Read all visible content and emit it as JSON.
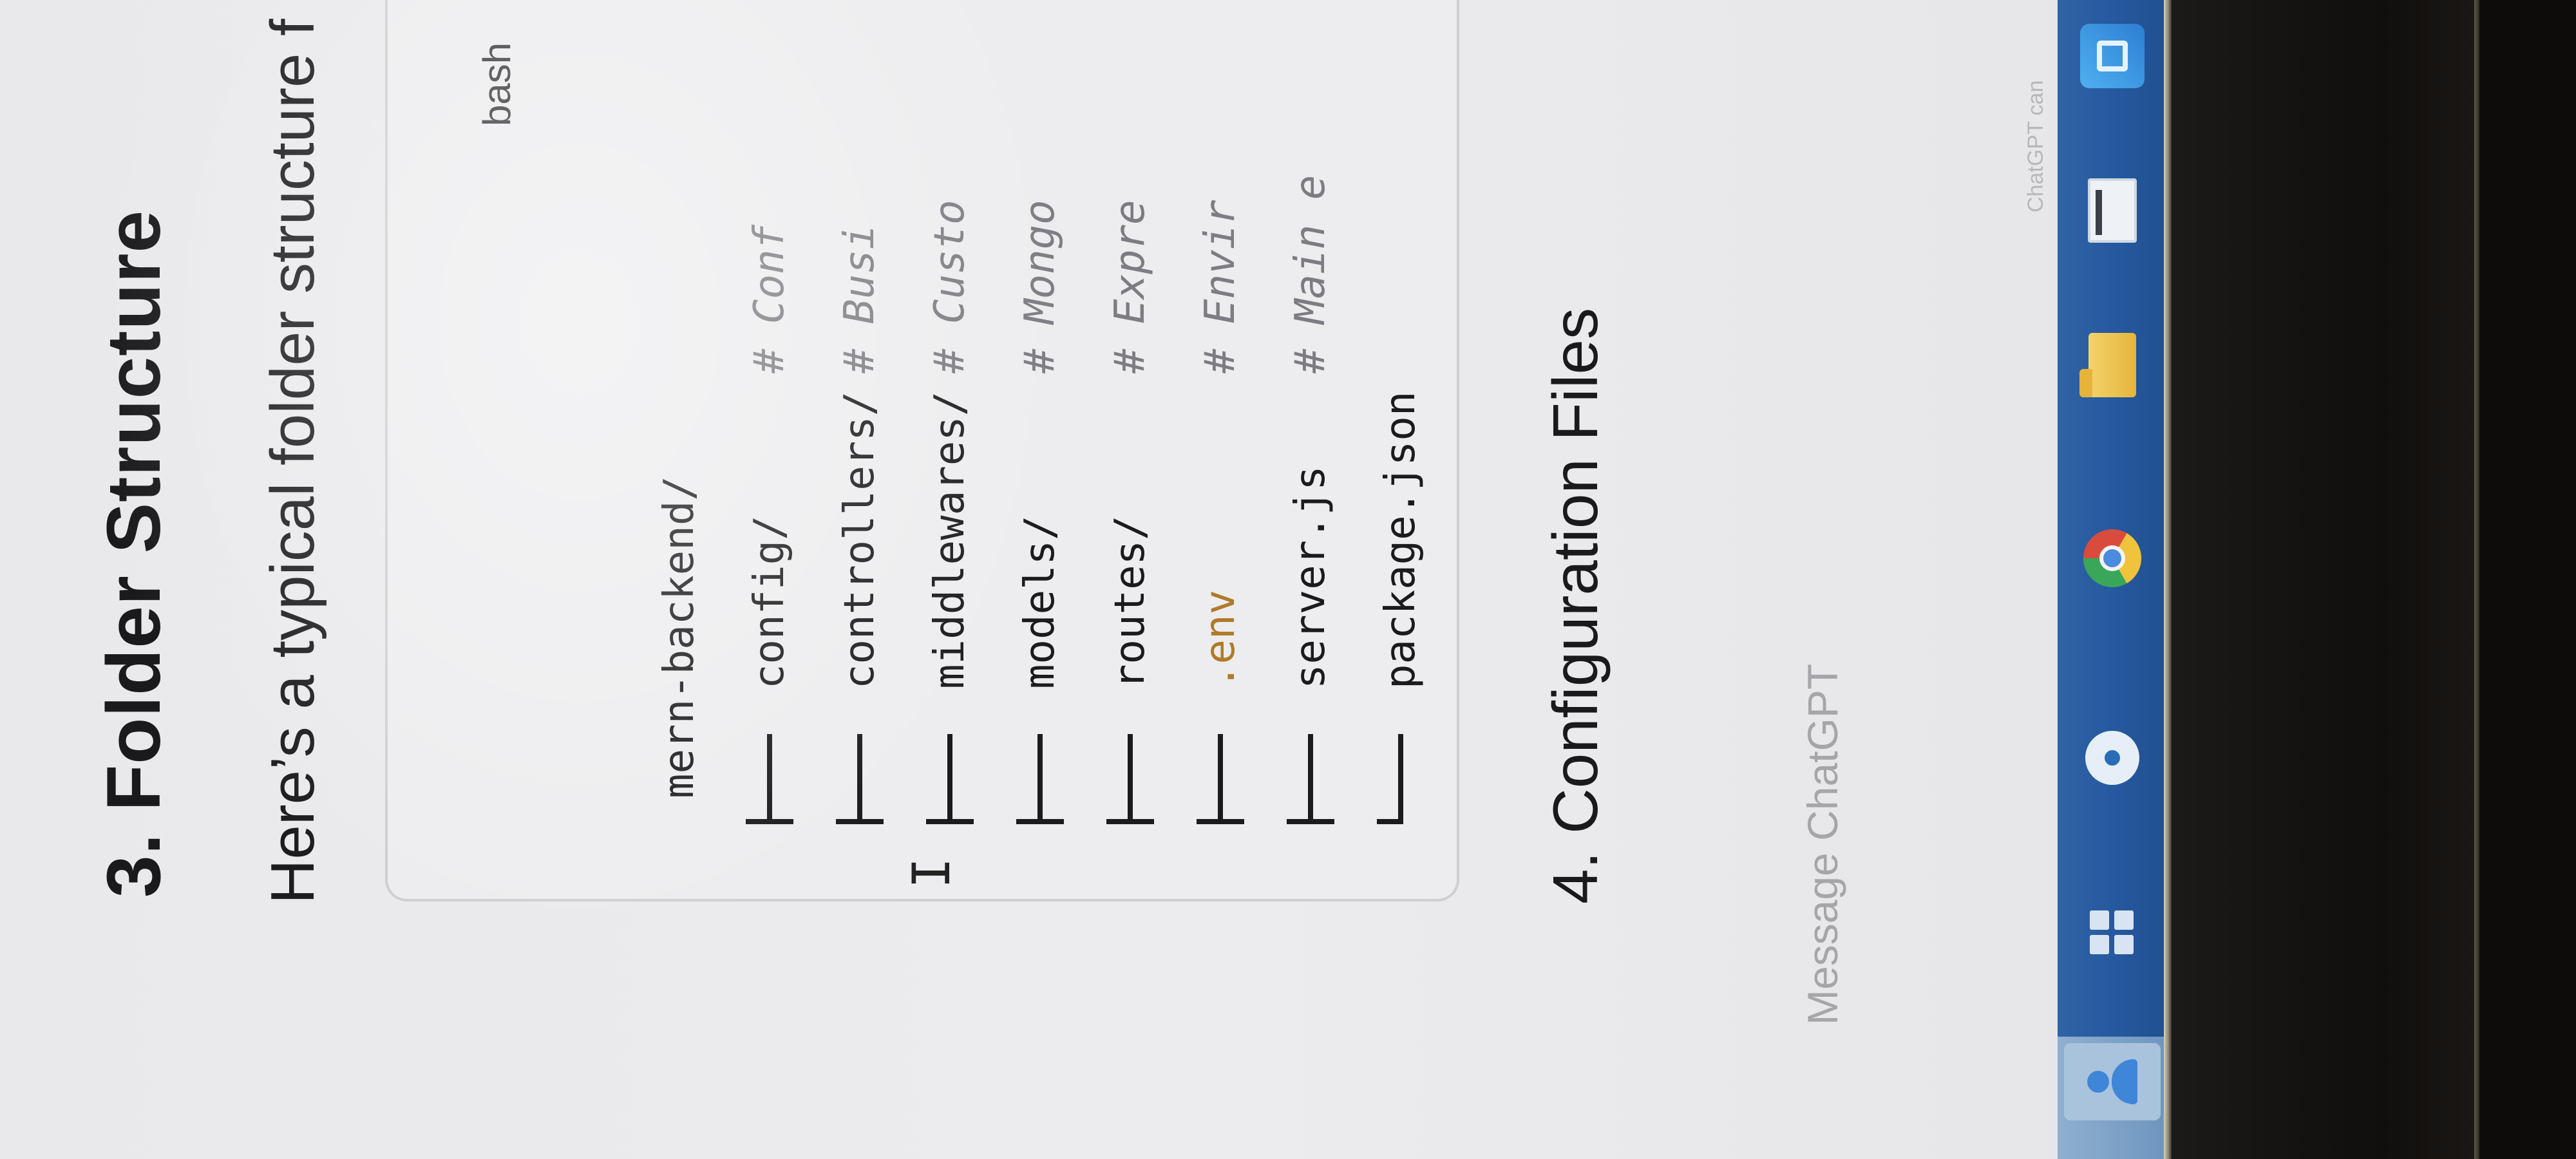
{
  "page": {
    "heading": "3. Folder Structure",
    "intro": "Here’s a typical folder structure f",
    "code_block": {
      "language": "bash",
      "root": "mern-backend/",
      "entries": [
        {
          "name": "config/",
          "comment": "# Conf"
        },
        {
          "name": "controllers/",
          "comment": "# Busi"
        },
        {
          "name": "middlewares/",
          "comment": "# Custo"
        },
        {
          "name": "models/",
          "comment": "# Mongo"
        },
        {
          "name": "routes/",
          "comment": "# Expre"
        },
        {
          "name": ".env",
          "comment": "# Envir"
        },
        {
          "name": "server.js",
          "comment": "# Main e"
        },
        {
          "name": "package.json",
          "comment": ""
        }
      ]
    },
    "next_heading": "4. Configuration Files"
  },
  "chat": {
    "placeholder": "Message ChatGPT",
    "disclaimer": "ChatGPT can"
  },
  "taskbar": {
    "icons": [
      "user-icon",
      "task-view-icon",
      "edge-browser-icon",
      "chrome-icon",
      "file-explorer-icon",
      "window-app-icon",
      "blue-app-icon"
    ]
  },
  "colors": {
    "screen_bg": "#ececee",
    "text": "#1a1a1c",
    "code_bg": "#ededef",
    "comment": "#7c7c82",
    "env_highlight": "#b07a2a",
    "taskbar": "#2659a0"
  }
}
